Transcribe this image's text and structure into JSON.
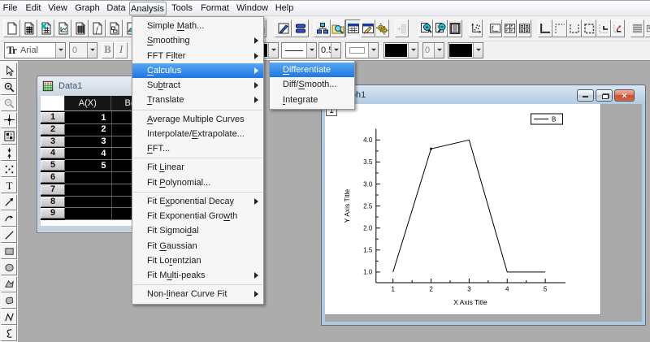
{
  "menubar": {
    "items": [
      "File",
      "Edit",
      "View",
      "Graph",
      "Data",
      "Analysis",
      "Tools",
      "Format",
      "Window",
      "Help"
    ],
    "open_item": "Analysis"
  },
  "toolbar_standard": {
    "buttons": [
      {
        "icon": "new-project"
      },
      {
        "icon": "new-worksheet"
      },
      {
        "icon": "new-excel"
      },
      {
        "icon": "new-graph"
      },
      {
        "icon": "new-matrix"
      },
      {
        "icon": "new-function"
      },
      {
        "icon": "new-layout"
      },
      {
        "icon": "open"
      },
      {
        "icon": "open-template"
      },
      {
        "icon": "save-project"
      },
      {
        "icon": "duplicate"
      },
      {
        "icon": "project-explorer"
      },
      {
        "icon": "explorer-folder"
      },
      {
        "icon": "results-log",
        "state": "pressed"
      },
      {
        "icon": "script-window"
      },
      {
        "icon": "code-builder"
      },
      {
        "icon": "attach",
        "state": "disabled"
      },
      {
        "icon": "zoom-in-page"
      },
      {
        "icon": "zoom-out-page"
      },
      {
        "icon": "whole-page"
      },
      {
        "icon": "rescale"
      },
      {
        "icon": "layer-layout"
      },
      {
        "icon": "layer-grid"
      },
      {
        "icon": "layer-grid2"
      },
      {
        "icon": "axis-bottom-left"
      },
      {
        "icon": "axis-top-left"
      },
      {
        "icon": "axis-bottom-right"
      },
      {
        "icon": "axis-box"
      },
      {
        "icon": "axis-corner"
      },
      {
        "icon": "axis-recreate"
      },
      {
        "icon": "gridlines"
      },
      {
        "icon": "legend-partial"
      }
    ]
  },
  "toolbar_format": {
    "font_icon": "Tr",
    "font_name": "Arial",
    "font_size": "0",
    "bold_label": "B",
    "italic_label": "I",
    "line_width": "0.5",
    "secondary_size": "0"
  },
  "tool_palette": {
    "tools": [
      "pointer",
      "zoom-in",
      "zoom-out",
      "data-reader",
      "screen-reader",
      "data-selector",
      "region-dots",
      "text-tool",
      "arrow-tool",
      "curved-arrow",
      "line-tool",
      "rect-tool",
      "circle-tool",
      "polygon-tool",
      "region-tool",
      "polyline-tool",
      "freehand-tool"
    ]
  },
  "data_window": {
    "title": "Data1",
    "columns": [
      "A(X)",
      "B(Y)"
    ],
    "row_numbers": [
      "1",
      "2",
      "3",
      "4",
      "5",
      "6",
      "7",
      "8",
      "9"
    ],
    "values_a": [
      "1",
      "2",
      "3",
      "4",
      "5",
      "",
      "",
      "",
      ""
    ]
  },
  "analysis_menu": {
    "items": [
      {
        "label": "Simple Math...",
        "accel": "M"
      },
      {
        "label": "Smoothing",
        "accel": "S",
        "submenu": true
      },
      {
        "label": "FFT Filter",
        "accel": "i",
        "submenu": true
      },
      {
        "label": "Calculus",
        "accel": "C",
        "submenu": true,
        "highlighted": true
      },
      {
        "label": "Subtract",
        "accel": "b",
        "submenu": true
      },
      {
        "label": "Translate",
        "accel": "T",
        "submenu": true
      },
      {
        "separator": true
      },
      {
        "label": "Average Multiple Curves",
        "accel": "A"
      },
      {
        "label": "Interpolate/Extrapolate...",
        "accel": "E"
      },
      {
        "label": "FFT...",
        "accel": "F"
      },
      {
        "separator": true
      },
      {
        "label": "Fit Linear",
        "accel": "L"
      },
      {
        "label": "Fit Polynomial...",
        "accel": "P"
      },
      {
        "separator": true
      },
      {
        "label": "Fit Exponential Decay",
        "accel": "x",
        "submenu": true
      },
      {
        "label": "Fit Exponential Growth",
        "accel": "w"
      },
      {
        "label": "Fit Sigmoidal",
        "accel": "d"
      },
      {
        "label": "Fit Gaussian",
        "accel": "G"
      },
      {
        "label": "Fit Lorentzian",
        "accel": "r"
      },
      {
        "label": "Fit Multi-peaks",
        "accel": "u",
        "submenu": true
      },
      {
        "separator": true
      },
      {
        "label": "Non-linear Curve Fit",
        "accel": "l",
        "submenu": true
      }
    ]
  },
  "calculus_submenu": {
    "items": [
      {
        "label": "Differentiate",
        "accel": "D",
        "highlighted": true
      },
      {
        "label": "Diff/Smooth...",
        "accel": "S"
      },
      {
        "label": "Integrate",
        "accel": "I"
      }
    ]
  },
  "graph_window": {
    "title": "Graph1",
    "caption_buttons": [
      "minimize",
      "restore",
      "close"
    ],
    "layer_badge": "1",
    "legend_label": "B"
  },
  "chart_data": {
    "type": "line",
    "x": [
      1,
      2,
      3,
      4,
      5
    ],
    "series": [
      {
        "name": "B",
        "values": [
          1.0,
          3.8,
          4.0,
          1.0,
          1.0
        ]
      }
    ],
    "title": "",
    "xlabel": "X Axis Title",
    "ylabel": "Y Axis Title",
    "x_ticks": [
      1,
      2,
      3,
      4,
      5
    ],
    "y_ticks": [
      1.0,
      1.5,
      2.0,
      2.5,
      3.0,
      3.5,
      4.0
    ],
    "xlim": [
      0.55,
      5.45
    ],
    "ylim": [
      0.76,
      4.26
    ],
    "grid": false,
    "legend_position": "top-right",
    "line_color": "#000000"
  },
  "colors": {
    "menu_highlight": "#2F86E8",
    "workspace": "#ACACAC",
    "toolbar": "#F1F1F1",
    "sheet_background": "#000000",
    "close_button": "#CC4D2E"
  }
}
